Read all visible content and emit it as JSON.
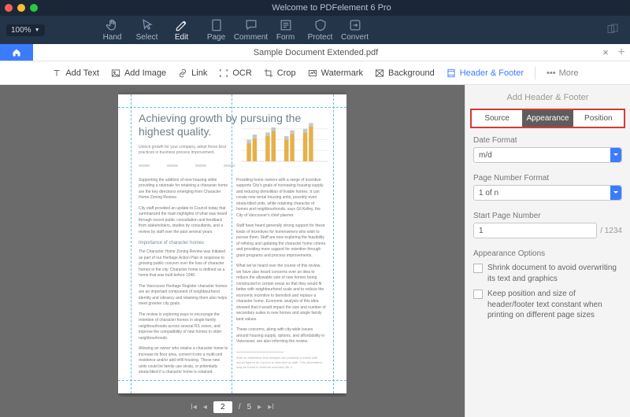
{
  "titlebar": {
    "title": "Welcome to PDFelement 6 Pro"
  },
  "zoom": {
    "value": "100%"
  },
  "main_tools": {
    "hand": "Hand",
    "select": "Select",
    "edit": "Edit",
    "page": "Page",
    "comment": "Comment",
    "form": "Form",
    "protect": "Protect",
    "convert": "Convert"
  },
  "doc": {
    "name": "Sample Document Extended.pdf",
    "page_current": "2",
    "page_sep": "/",
    "page_total": "5"
  },
  "sub_tools": {
    "add_text": "Add Text",
    "add_image": "Add Image",
    "link": "Link",
    "ocr": "OCR",
    "crop": "Crop",
    "watermark": "Watermark",
    "background": "Background",
    "header_footer": "Header & Footer",
    "more": "More"
  },
  "page_content": {
    "title": "Achieving growth by pursuing the highest quality.",
    "intro": "Unlock growth for your company, adopt these best practices in business process improvement.",
    "subhead": "Importance of character homes"
  },
  "panel": {
    "title": "Add Header & Footer",
    "tabs": {
      "source": "Source",
      "appearance": "Appearance",
      "position": "Position"
    },
    "date_format_label": "Date Format",
    "date_format_value": "m/d",
    "pagenum_format_label": "Page Number Format",
    "pagenum_format_value": "1 of n",
    "start_page_label": "Start Page Number",
    "start_page_value": "1",
    "start_page_suffix": "/ 1234",
    "appearance_options_label": "Appearance Options",
    "opt_shrink": "Shrink document to avoid overwriting its text and graphics",
    "opt_keep": "Keep position and size of header/footer text constant when printing on different page sizes"
  }
}
